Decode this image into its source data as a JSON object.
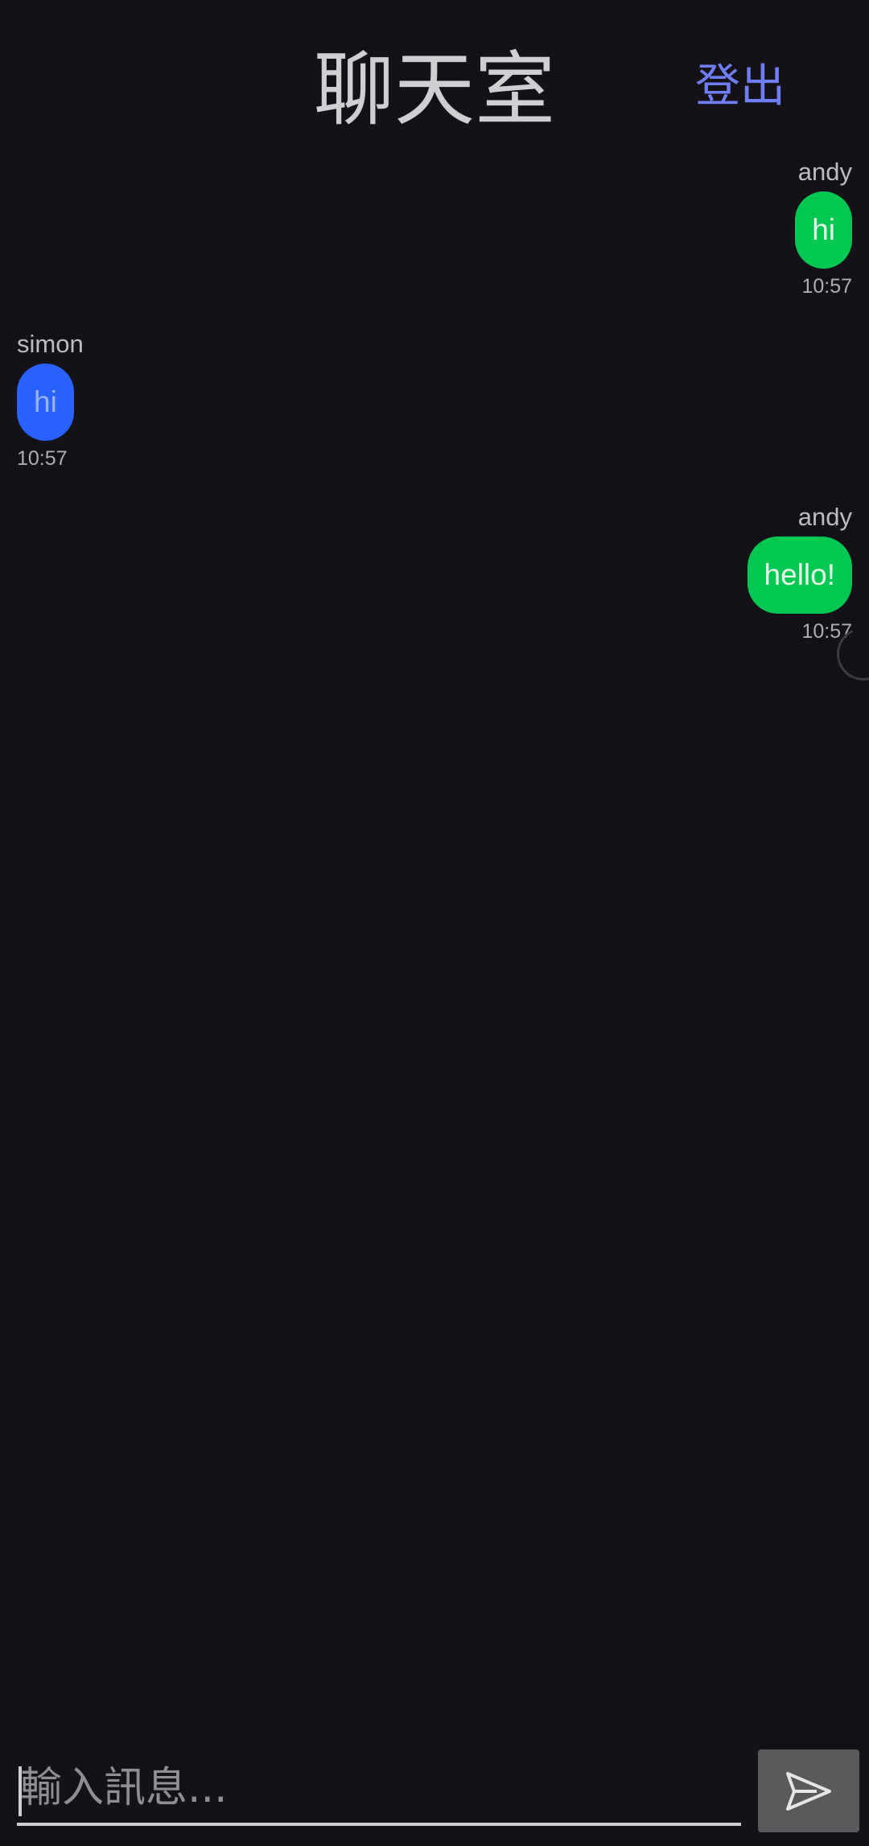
{
  "header": {
    "title": "聊天室",
    "logout_label": "登出"
  },
  "messages": [
    {
      "sender": "andy",
      "text": "hi",
      "time": "10:57",
      "side": "right"
    },
    {
      "sender": "simon",
      "text": "hi",
      "time": "10:57",
      "side": "left"
    },
    {
      "sender": "andy",
      "text": "hello!",
      "time": "10:57",
      "side": "right"
    }
  ],
  "composer": {
    "placeholder": "輸入訊息...",
    "value": ""
  },
  "icons": {
    "send": "send-icon"
  },
  "colors": {
    "background": "#141218",
    "own_bubble": "#00c853",
    "other_bubble": "#2962ff",
    "accent": "#6e7ff5",
    "send_button": "#5a5a5d"
  }
}
